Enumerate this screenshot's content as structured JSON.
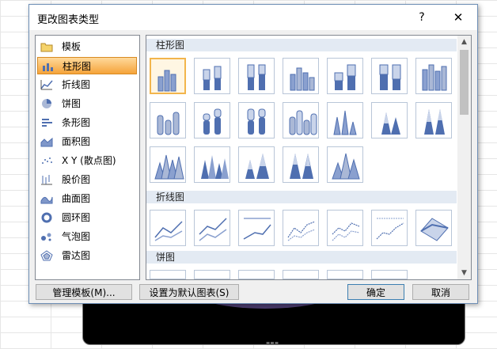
{
  "dialog": {
    "title": "更改图表类型",
    "help": "?",
    "close": "✕"
  },
  "categories": [
    {
      "label": "模板",
      "icon": "folder-icon"
    },
    {
      "label": "柱形图",
      "icon": "column-chart-icon",
      "selected": true
    },
    {
      "label": "折线图",
      "icon": "line-chart-icon"
    },
    {
      "label": "饼图",
      "icon": "pie-chart-icon"
    },
    {
      "label": "条形图",
      "icon": "bar-chart-icon"
    },
    {
      "label": "面积图",
      "icon": "area-chart-icon"
    },
    {
      "label": "X Y (散点图)",
      "icon": "scatter-chart-icon"
    },
    {
      "label": "股价图",
      "icon": "stock-chart-icon"
    },
    {
      "label": "曲面图",
      "icon": "surface-chart-icon"
    },
    {
      "label": "圆环图",
      "icon": "doughnut-chart-icon"
    },
    {
      "label": "气泡图",
      "icon": "bubble-chart-icon"
    },
    {
      "label": "雷达图",
      "icon": "radar-chart-icon"
    }
  ],
  "sections": {
    "column": "柱形图",
    "line": "折线图",
    "pie": "饼图"
  },
  "buttons": {
    "manage_templates": "管理模板(M)...",
    "set_default": "设置为默认图表(S)",
    "ok": "确定",
    "cancel": "取消"
  },
  "colors": {
    "selected_gradient_top": "#ffd99b",
    "selected_gradient_bottom": "#f5a33a",
    "section_bg": "#e3eaf3",
    "chart_blue": "#4f6fb0"
  }
}
